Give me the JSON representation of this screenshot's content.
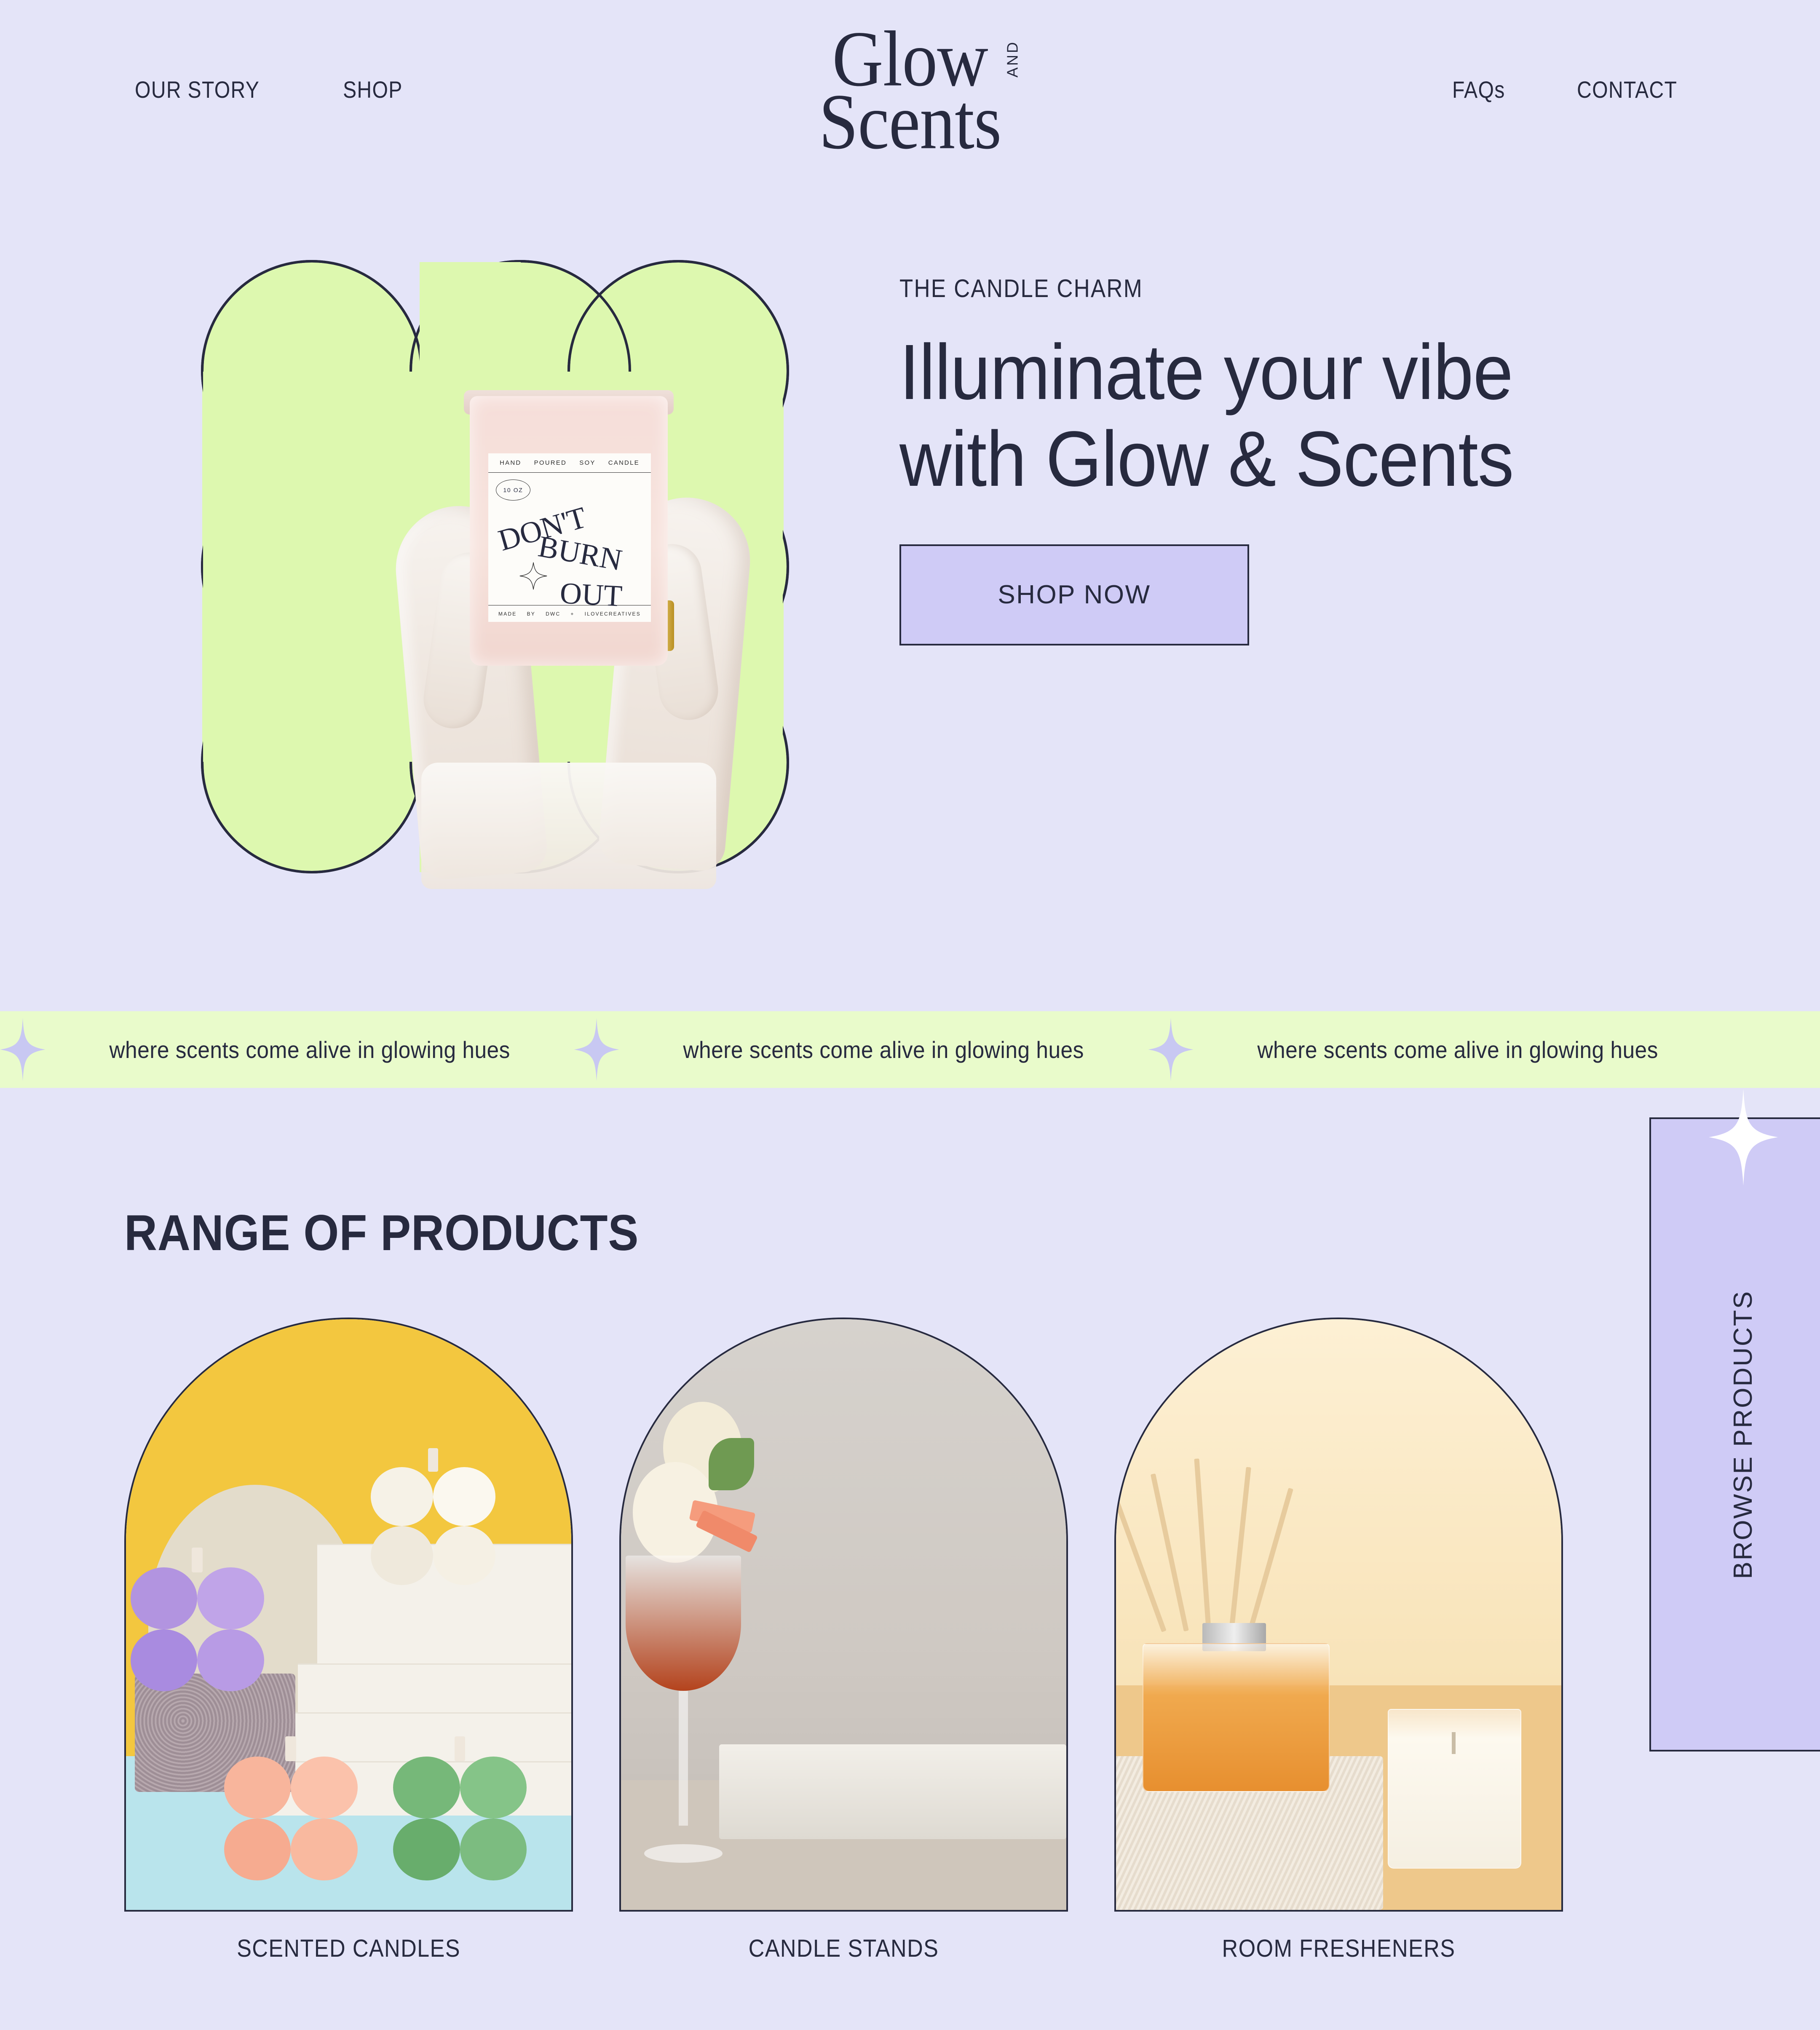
{
  "brand": {
    "logo_line1": "Glow",
    "logo_and": "AND",
    "logo_line2": "Scents"
  },
  "nav": {
    "left": [
      {
        "label": "OUR STORY",
        "name": "nav-our-story"
      },
      {
        "label": "SHOP",
        "name": "nav-shop"
      }
    ],
    "right": [
      {
        "label": "FAQs",
        "name": "nav-faqs"
      },
      {
        "label": "CONTACT",
        "name": "nav-contact"
      }
    ]
  },
  "hero": {
    "eyebrow": "THE CANDLE CHARM",
    "title": "Illuminate your vibe with Glow & Scents",
    "cta_label": "SHOP NOW",
    "image_alt": "hands-holding-candle",
    "candle_label": {
      "top_words": [
        "HAND",
        "POURED",
        "SOY",
        "CANDLE"
      ],
      "size_badge": "10 OZ",
      "headline_1": "DON'T",
      "headline_2": "BURN",
      "headline_3": "OUT",
      "bottom_words": [
        "MADE",
        "BY",
        "DWC",
        "+",
        "ILOVECREATIVES"
      ]
    }
  },
  "marquee": {
    "text": "where scents come alive in glowing hues",
    "repeats": 3,
    "star_icon": "sparkle-icon"
  },
  "products": {
    "section_title": "RANGE OF PRODUCTS",
    "cards": [
      {
        "label": "SCENTED CANDLES",
        "name": "product-card-scented-candles"
      },
      {
        "label": "CANDLE STANDS",
        "name": "product-card-candle-stands"
      },
      {
        "label": "ROOM FRESHENERS",
        "name": "product-card-room-fresheners"
      }
    ],
    "browse_label": "BROWSE PRODUCTS"
  },
  "colors": {
    "background": "#e4e4f8",
    "accent_green": "#e9fbcb",
    "accent_lavender": "#cfcbf6",
    "ink": "#272a3f",
    "blob_green": "#ddf8af",
    "sparkle_lavender": "#c8c8f2"
  }
}
